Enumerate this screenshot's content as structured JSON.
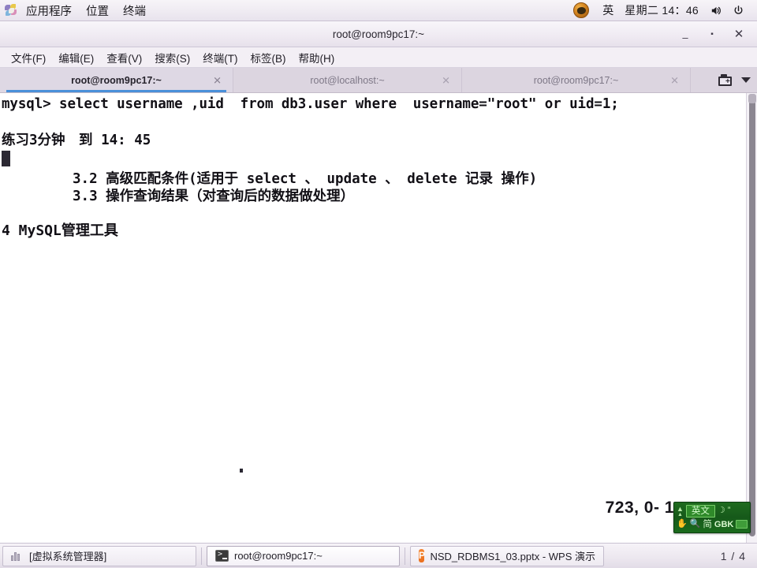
{
  "panel": {
    "app_menu_icon": "flower-icon",
    "menus": [
      {
        "label": "应用程序"
      },
      {
        "label": "位置"
      },
      {
        "label": "终端"
      }
    ],
    "tray": {
      "circle_icon": "fedora-icon",
      "input_method": "英",
      "clock": "星期二 14：46",
      "volume_icon": "volume-icon",
      "power_icon": "power-icon"
    }
  },
  "window": {
    "title": "root@room9pc17:~",
    "controls": {
      "minimize": "‒",
      "maximize": "▪",
      "close": "✕"
    },
    "menubar": [
      {
        "label": "文件(F)"
      },
      {
        "label": "编辑(E)"
      },
      {
        "label": "查看(V)"
      },
      {
        "label": "搜索(S)"
      },
      {
        "label": "终端(T)"
      },
      {
        "label": "标签(B)"
      },
      {
        "label": "帮助(H)"
      }
    ],
    "tabs": [
      {
        "label": "root@room9pc17:~",
        "active": true,
        "close": "✕"
      },
      {
        "label": "root@localhost:~",
        "active": false,
        "close": "✕"
      },
      {
        "label": "root@room9pc17:~",
        "active": false,
        "close": "✕"
      }
    ],
    "tabbar_actions": {
      "new_tab_icon": "new-tab-icon",
      "tab_list_icon": "chevron-down-icon"
    }
  },
  "terminal": {
    "command_line": "mysql> select username ,uid  from db3.user where  username=\"root\" or uid=1;",
    "practice_line": "练习3分钟　到 14: 45",
    "outline_32": "3.2 高级匹配条件(适用于 select 、 update 、 delete 记录 操作)",
    "outline_33": "3.3 操作查询结果（对查询后的数据做处理）",
    "outline_4": "4 MySQL管理工具",
    "status_count": "723, 0- 1"
  },
  "ime": {
    "collapse_icon": "chevron-up-icon",
    "mode": "英文",
    "moon_icon": "moon-icon",
    "quote_icon": "quote-icon",
    "hand_icon": "hand-icon",
    "search_icon": "search-icon",
    "charset_simplified": "简",
    "encoding": "GBK",
    "keyboard_icon": "keyboard-icon"
  },
  "taskbar": {
    "items": [
      {
        "label": "[虚拟系统管理器]",
        "icon": "vm-manager-icon",
        "active": false
      },
      {
        "label": "root@room9pc17:~",
        "icon": "terminal-icon",
        "active": true
      },
      {
        "label": "NSD_RDBMS1_03.pptx - WPS 演示",
        "icon": "wps-icon",
        "active": false
      }
    ],
    "workspace": "1 / 4"
  },
  "colors": {
    "panel_bg": "#efebf2",
    "tab_active_underline": "#4a90d9",
    "terminal_bg": "#ffffff",
    "terminal_fg": "#121016",
    "ime_bg": "#16591a",
    "wps_orange": "#ea6f1e"
  }
}
